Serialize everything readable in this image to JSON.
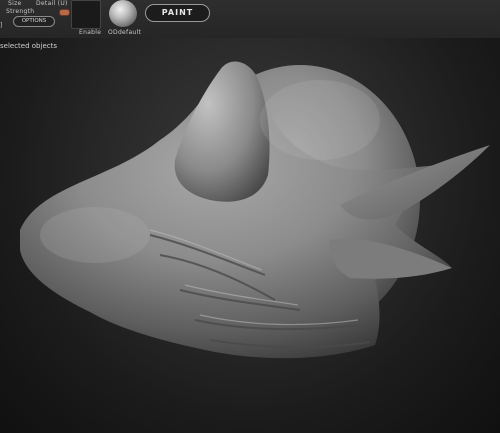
{
  "toolbar": {
    "size_label": "Size",
    "detail_label": "Detail (U)",
    "strength_label": "Strength",
    "options_label": "OPTIONS",
    "enable_label": "Enable",
    "material_label": "ODdefault",
    "paint_label": "PAINT",
    "bracket_label": "]"
  },
  "status": {
    "selected_label": "selected objects"
  },
  "colors": {
    "background": "#1a1a1a",
    "model": "#8a8a8a",
    "accent": "#b86a48"
  }
}
